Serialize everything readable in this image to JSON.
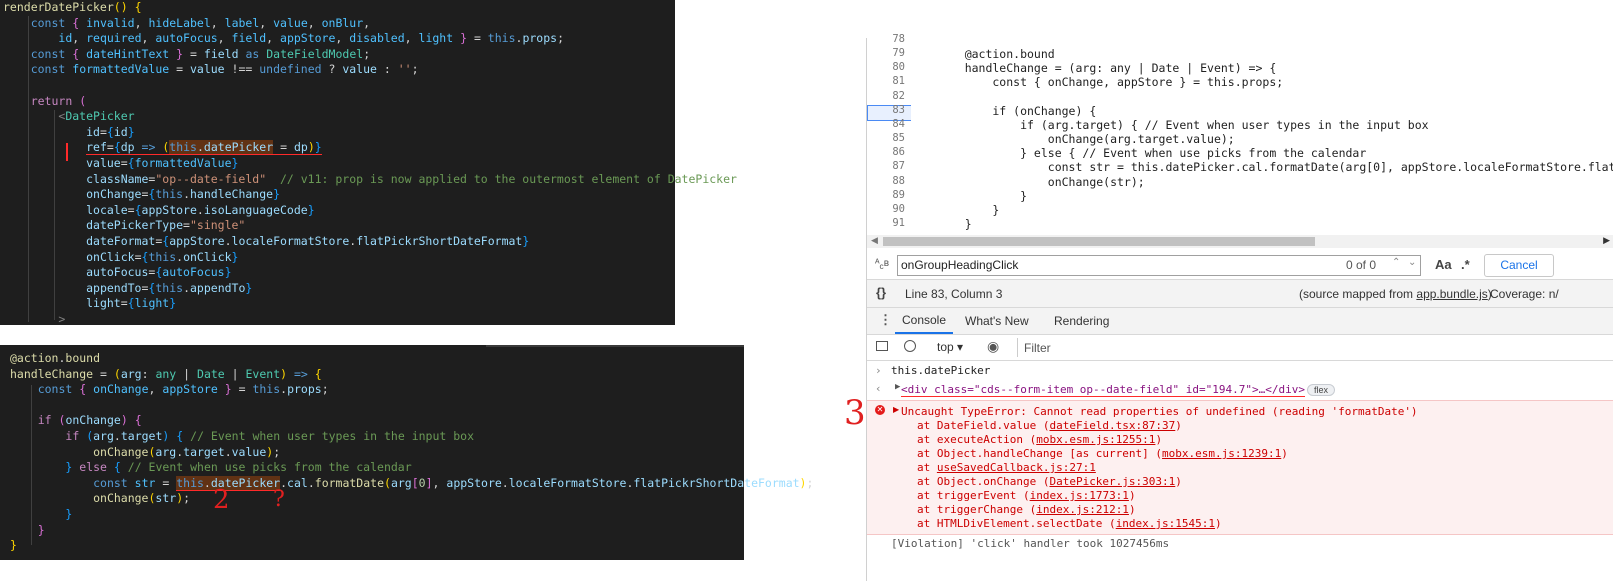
{
  "top_left_code": {
    "lines": [
      "renderDatePicker() {",
      "    const { invalid, hideLabel, label, value, onBlur,",
      "        id, required, autoFocus, field, appStore, disabled, light } = this.props;",
      "    const { dateHintText } = field as DateFieldModel;",
      "    const formattedValue = value !== undefined ? value : '';",
      "",
      "    return (",
      "        <DatePicker",
      "            id={id}",
      "            ref={dp => (this.datePicker = dp)}",
      "            value={formattedValue}",
      "            className=\"op--date-field\"  // v11: prop is now applied to the outermost element of DatePicker",
      "            onChange={this.handleChange}",
      "            locale={appStore.isoLanguageCode}",
      "            datePickerType=\"single\"",
      "            dateFormat={appStore.localeFormatStore.flatPickrShortDateFormat}",
      "            onClick={this.onClick}",
      "            autoFocus={autoFocus}",
      "            appendTo={this.appendTo}",
      "            light={light}",
      "        >"
    ]
  },
  "bottom_left_code": {
    "lines": [
      "@action.bound",
      "handleChange = (arg: any | Date | Event) => {",
      "    const { onChange, appStore } = this.props;",
      "",
      "    if (onChange) {",
      "        if (arg.target) { // Event when user types in the input box",
      "            onChange(arg.target.value);",
      "        } else { // Event when use picks from the calendar",
      "            const str = this.datePicker.cal.formatDate(arg[0], appStore.localeFormatStore.flatPickrShortDateFormat);",
      "            onChange(str);",
      "        }",
      "    }",
      "}"
    ],
    "annotation_2": "2",
    "annotation_q": "?"
  },
  "devtools": {
    "source_lines": [
      {
        "num": "78",
        "text": ""
      },
      {
        "num": "79",
        "text": "    @action.bound"
      },
      {
        "num": "80",
        "text": "    handleChange = (arg: any | Date | Event) => {"
      },
      {
        "num": "81",
        "text": "        const { onChange, appStore } = this.props;"
      },
      {
        "num": "82",
        "text": ""
      },
      {
        "num": "83",
        "text": "        if (onChange) {"
      },
      {
        "num": "84",
        "text": "            if (arg.target) { // Event when user types in the input box"
      },
      {
        "num": "85",
        "text": "                onChange(arg.target.value);"
      },
      {
        "num": "86",
        "text": "            } else { // Event when use picks from the calendar"
      },
      {
        "num": "87",
        "text": "                const str = this.datePicker.cal.formatDate(arg[0], appStore.localeFormatStore.flatPi"
      },
      {
        "num": "88",
        "text": "                onChange(str);"
      },
      {
        "num": "89",
        "text": "            }"
      },
      {
        "num": "90",
        "text": "        }"
      },
      {
        "num": "91",
        "text": "    }"
      }
    ],
    "search": {
      "value": "onGroupHeadingClick",
      "count": "0 of 0",
      "case_label": "Aa",
      "regex_label": ".*",
      "cancel_label": "Cancel"
    },
    "status": {
      "position": "Line 83, Column 3",
      "source_mapped_prefix": "(source mapped from ",
      "source_mapped_link": "app.bundle.js",
      "source_mapped_suffix": ")",
      "coverage": "Coverage: n/"
    },
    "tabs": [
      "Console",
      "What's New",
      "Rendering"
    ],
    "console_toolbar": {
      "context": "top",
      "filter_placeholder": "Filter"
    },
    "console": {
      "input": "this.datePicker",
      "result": "<div class=\"cds--form-item op--date-field\" id=\"194.7\">…</div>",
      "result_badge": "flex",
      "error_title": "Uncaught TypeError: Cannot read properties of undefined (reading 'formatDate')",
      "stack": [
        {
          "prefix": "at DateField.value (",
          "link": "dateField.tsx:87:37",
          "suffix": ")"
        },
        {
          "prefix": "at executeAction (",
          "link": "mobx.esm.js:1255:1",
          "suffix": ")"
        },
        {
          "prefix": "at Object.handleChange [as current] (",
          "link": "mobx.esm.js:1239:1",
          "suffix": ")"
        },
        {
          "prefix": "at ",
          "link": "useSavedCallback.js:27:1",
          "suffix": ""
        },
        {
          "prefix": "at Object.onChange (",
          "link": "DatePicker.js:303:1",
          "suffix": ")"
        },
        {
          "prefix": "at triggerEvent (",
          "link": "index.js:1773:1",
          "suffix": ")"
        },
        {
          "prefix": "at triggerChange (",
          "link": "index.js:212:1",
          "suffix": ")"
        },
        {
          "prefix": "at HTMLDivElement.selectDate (",
          "link": "index.js:1545:1",
          "suffix": ")"
        }
      ],
      "violation": "[Violation] 'click' handler took 1027456ms"
    },
    "annotation_3": "3"
  }
}
